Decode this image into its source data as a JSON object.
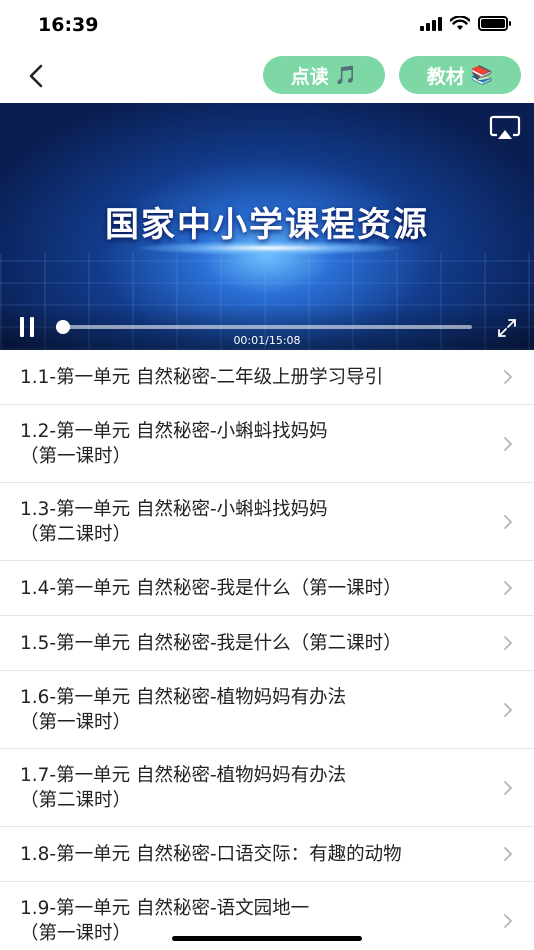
{
  "status_bar": {
    "time": "16:39"
  },
  "nav": {
    "read_label": "点读",
    "read_icon": "🎵",
    "textbook_label": "教材",
    "textbook_icon": "📚",
    "accent_color": "#7dd8a6"
  },
  "video": {
    "title": "国家中小学课程资源",
    "time": "00:01/15:08",
    "progress": 0.001
  },
  "lessons": [
    {
      "title": "1.1-第一单元 自然秘密-二年级上册学习导引"
    },
    {
      "title": "1.2-第一单元 自然秘密-小蝌蚪找妈妈\n（第一课时）"
    },
    {
      "title": "1.3-第一单元 自然秘密-小蝌蚪找妈妈\n（第二课时）"
    },
    {
      "title": "1.4-第一单元 自然秘密-我是什么（第一课时）"
    },
    {
      "title": "1.5-第一单元 自然秘密-我是什么（第二课时）"
    },
    {
      "title": "1.6-第一单元 自然秘密-植物妈妈有办法\n（第一课时）"
    },
    {
      "title": "1.7-第一单元 自然秘密-植物妈妈有办法\n（第二课时）"
    },
    {
      "title": "1.8-第一单元 自然秘密-口语交际：有趣的动物"
    },
    {
      "title": "1.9-第一单元 自然秘密-语文园地一\n（第一课时）"
    }
  ]
}
